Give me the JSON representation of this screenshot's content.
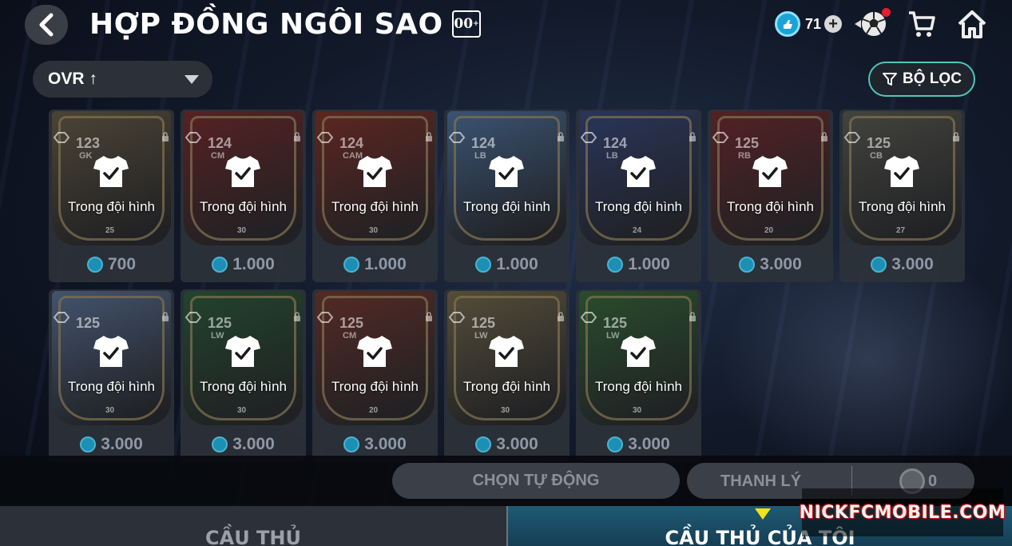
{
  "header": {
    "title": "HỢP ĐỒNG NGÔI SAO",
    "badge": "00",
    "currency_value": "71"
  },
  "toolbar": {
    "sort_label": "OVR ↑",
    "filter_label": "BỘ LỌC"
  },
  "cards": [
    {
      "ovr": "123",
      "pos": "GK",
      "num": "25",
      "price": "700",
      "status": "Trong đội hình",
      "art_color": "#7a6a4a"
    },
    {
      "ovr": "124",
      "pos": "CM",
      "num": "30",
      "price": "1.000",
      "status": "Trong đội hình",
      "art_color": "#8e2a28"
    },
    {
      "ovr": "124",
      "pos": "CAM",
      "num": "30",
      "price": "1.000",
      "status": "Trong đội hình",
      "art_color": "#9a3424"
    },
    {
      "ovr": "124",
      "pos": "LB",
      "num": "",
      "price": "1.000",
      "status": "Trong đội hình",
      "art_color": "#5a86b8"
    },
    {
      "ovr": "124",
      "pos": "LB",
      "num": "24",
      "price": "1.000",
      "status": "Trong đội hình",
      "art_color": "#3c4f8c"
    },
    {
      "ovr": "125",
      "pos": "RB",
      "num": "20",
      "price": "3.000",
      "status": "Trong đội hình",
      "art_color": "#8a2a2a"
    },
    {
      "ovr": "125",
      "pos": "CB",
      "num": "27",
      "price": "3.000",
      "status": "Trong đội hình",
      "art_color": "#6a6a5a"
    },
    {
      "ovr": "125",
      "pos": "",
      "num": "30",
      "price": "3.000",
      "status": "Trong đội hình",
      "art_color": "#6a86b0"
    },
    {
      "ovr": "125",
      "pos": "LW",
      "num": "30",
      "price": "3.000",
      "status": "Trong đội hình",
      "art_color": "#2f6a3a"
    },
    {
      "ovr": "125",
      "pos": "CM",
      "num": "20",
      "price": "3.000",
      "status": "Trong đội hình",
      "art_color": "#8a3a2a"
    },
    {
      "ovr": "125",
      "pos": "LW",
      "num": "30",
      "price": "3.000",
      "status": "Trong đội hình",
      "art_color": "#8a7a50"
    },
    {
      "ovr": "125",
      "pos": "LW",
      "num": "30",
      "price": "3.000",
      "status": "Trong đội hình",
      "art_color": "#3a7a3a"
    }
  ],
  "actions": {
    "auto_select": "CHỌN TỰ ĐỘNG",
    "sell": "THANH LÝ",
    "sell_total": "0"
  },
  "tabs": {
    "players": "CẦU THỦ",
    "my_players": "CẦU THỦ CỦA TÔI"
  },
  "watermark": "NICKFCMOBILE.COM"
}
